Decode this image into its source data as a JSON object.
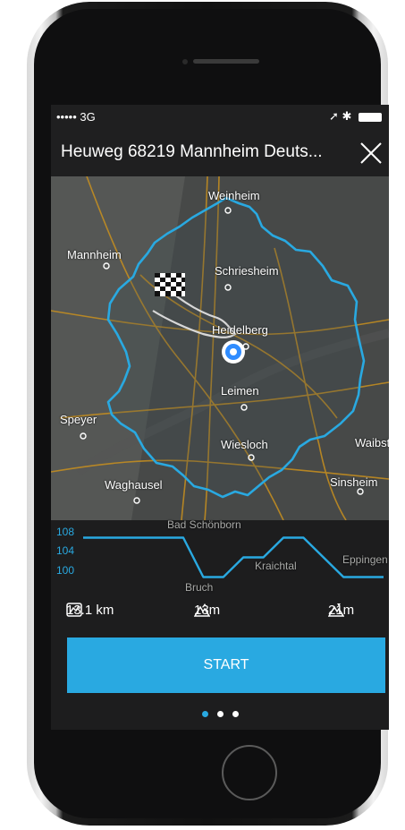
{
  "status_bar": {
    "carrier": "••••• 3G",
    "icons": "➚ ✱"
  },
  "header": {
    "address": "Heuweg 68219 Mannheim Deuts...",
    "close_icon": "close-icon"
  },
  "map": {
    "places": [
      {
        "name": "Weinheim",
        "dim": true
      },
      {
        "name": "Mannheim",
        "dim": false
      },
      {
        "name": "Schriesheim",
        "dim": false
      },
      {
        "name": "Heidelberg",
        "dim": false
      },
      {
        "name": "Leimen",
        "dim": false
      },
      {
        "name": "Speyer",
        "dim": true
      },
      {
        "name": "Wiesloch",
        "dim": false
      },
      {
        "name": "Waibst",
        "dim": true
      },
      {
        "name": "Waghausel",
        "dim": true
      },
      {
        "name": "Sinsheim",
        "dim": true
      },
      {
        "name": "Bad Schönborn",
        "dim": true
      },
      {
        "name": "Bruch",
        "dim": true
      },
      {
        "name": "Kraichtal",
        "dim": true
      },
      {
        "name": "Eppingen",
        "dim": true
      }
    ],
    "colors": {
      "isochrone": "#29a9e1",
      "current_location": "#2f8cff",
      "roads": "#c9901e"
    }
  },
  "elevation": {
    "y_ticks": [
      "108",
      "104",
      "100"
    ],
    "profile_values": [
      108,
      108,
      108,
      108,
      108,
      108,
      100,
      100,
      104,
      104,
      108,
      108,
      104,
      100,
      100,
      100
    ],
    "ylim": [
      99,
      109
    ],
    "line_color": "#29a9e1"
  },
  "stats": {
    "distance": "13.1 km",
    "ascent": "13m",
    "descent": "21m"
  },
  "start_button": {
    "label": "START"
  },
  "page_indicator": {
    "count": 3,
    "active": 0
  }
}
